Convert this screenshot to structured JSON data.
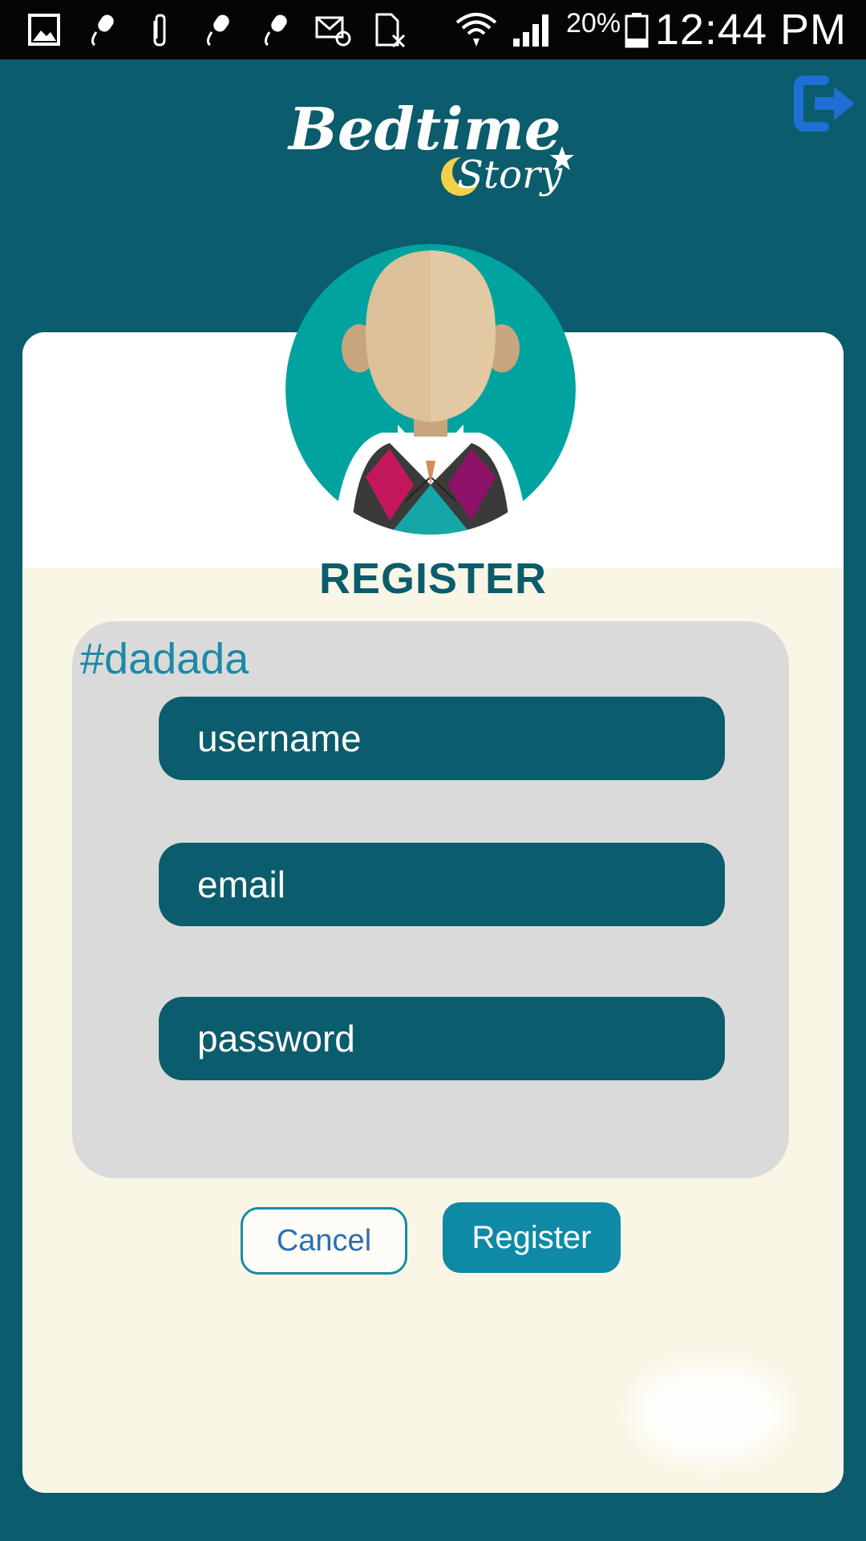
{
  "status_bar": {
    "battery": "20%",
    "time": "12:44 PM",
    "icons": [
      "gallery-icon",
      "mic-icon",
      "attachment-icon",
      "mic-icon",
      "mic-icon",
      "email-icon",
      "sim-icon",
      "wifi-icon",
      "signal-icon",
      "battery-icon"
    ]
  },
  "header": {
    "logo_word1": "Bedtime",
    "logo_word2": "Story",
    "logout_icon": "logout-icon"
  },
  "register": {
    "title": "REGISTER",
    "panel_label": "#dadada",
    "fields": [
      {
        "placeholder": "username",
        "value": ""
      },
      {
        "placeholder": "email",
        "value": ""
      },
      {
        "placeholder": "password",
        "value": ""
      }
    ],
    "cancel_label": "Cancel",
    "register_label": "Register"
  },
  "colors": {
    "background": "#0b5c6c",
    "card": "#faf6e6",
    "panel": "#dadada",
    "accent": "#0f8aa6"
  }
}
